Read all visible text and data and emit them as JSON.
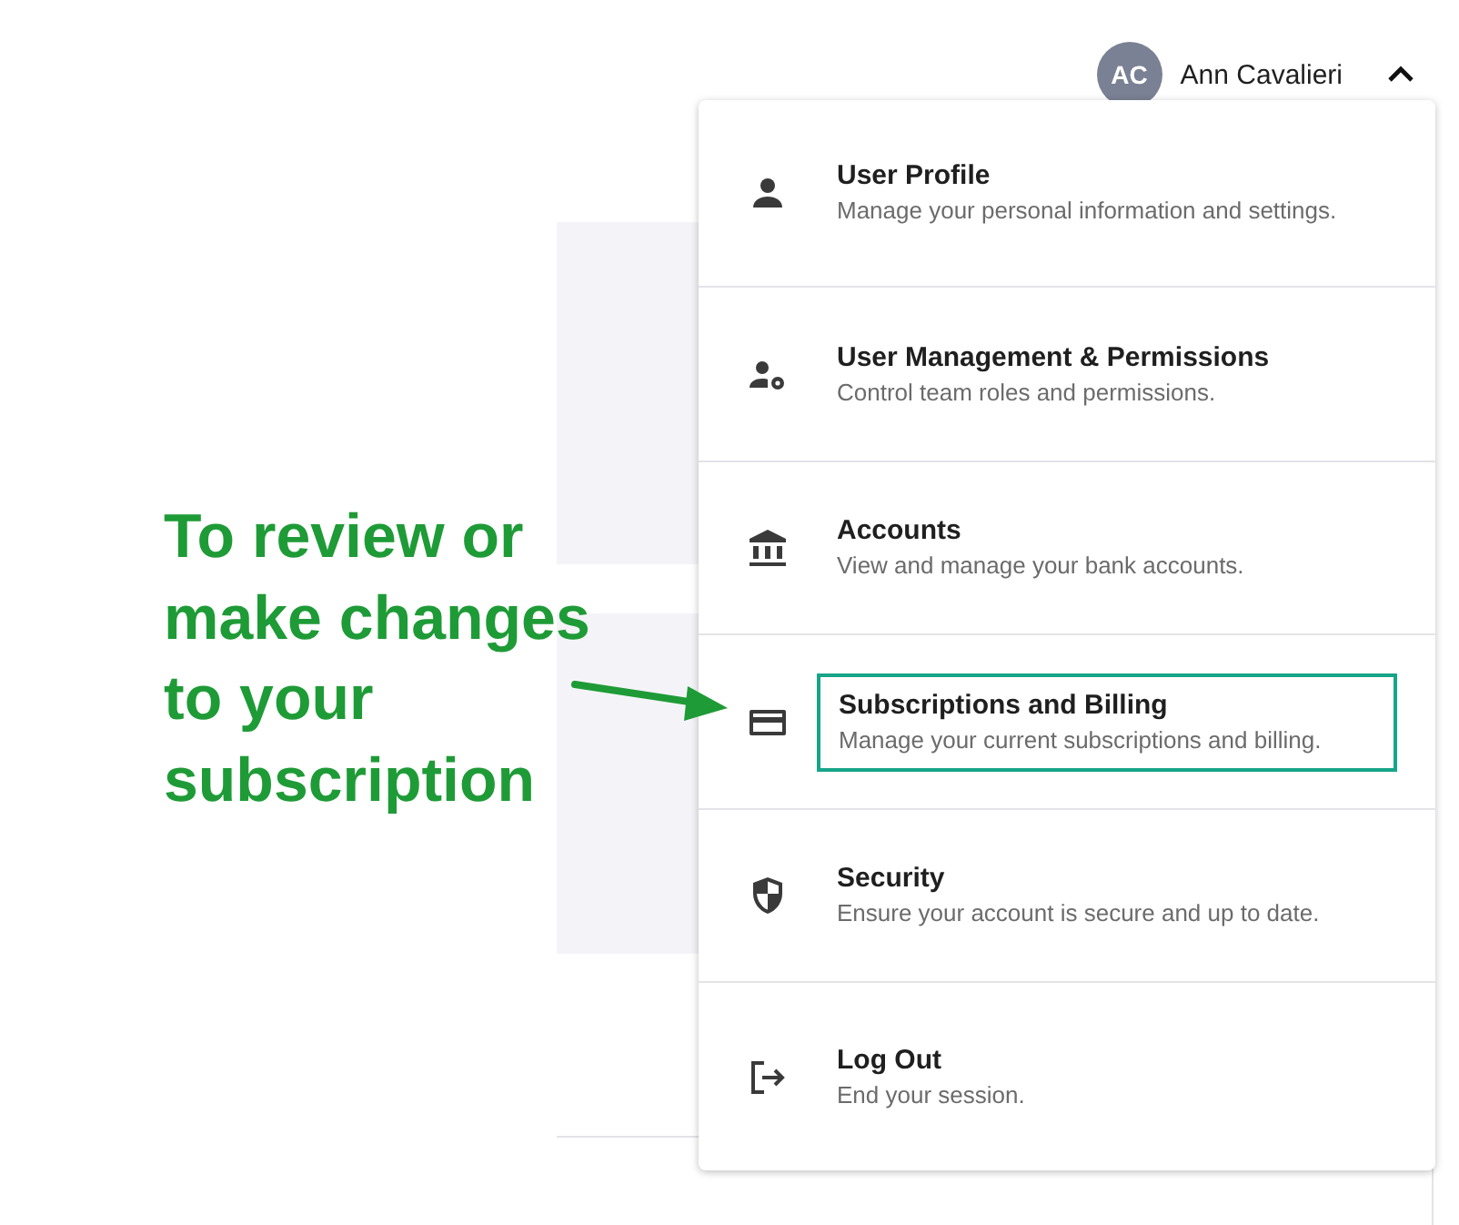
{
  "user": {
    "initials": "AC",
    "name": "Ann Cavalieri",
    "menu_open": true
  },
  "menu": [
    {
      "title": "User Profile",
      "description": "Manage your personal information and settings.",
      "highlighted": false
    },
    {
      "title": "User Management & Permissions",
      "description": "Control team roles and permissions.",
      "highlighted": false
    },
    {
      "title": "Accounts",
      "description": "View and manage your bank accounts.",
      "highlighted": false
    },
    {
      "title": "Subscriptions and Billing",
      "description": "Manage your current subscriptions and billing.",
      "highlighted": true
    },
    {
      "title": "Security",
      "description": "Ensure your account is secure and up to date.",
      "highlighted": false
    },
    {
      "title": "Log Out",
      "description": "End your session.",
      "highlighted": false
    }
  ],
  "annotation": {
    "text": "To review or make changes to your subscription"
  }
}
